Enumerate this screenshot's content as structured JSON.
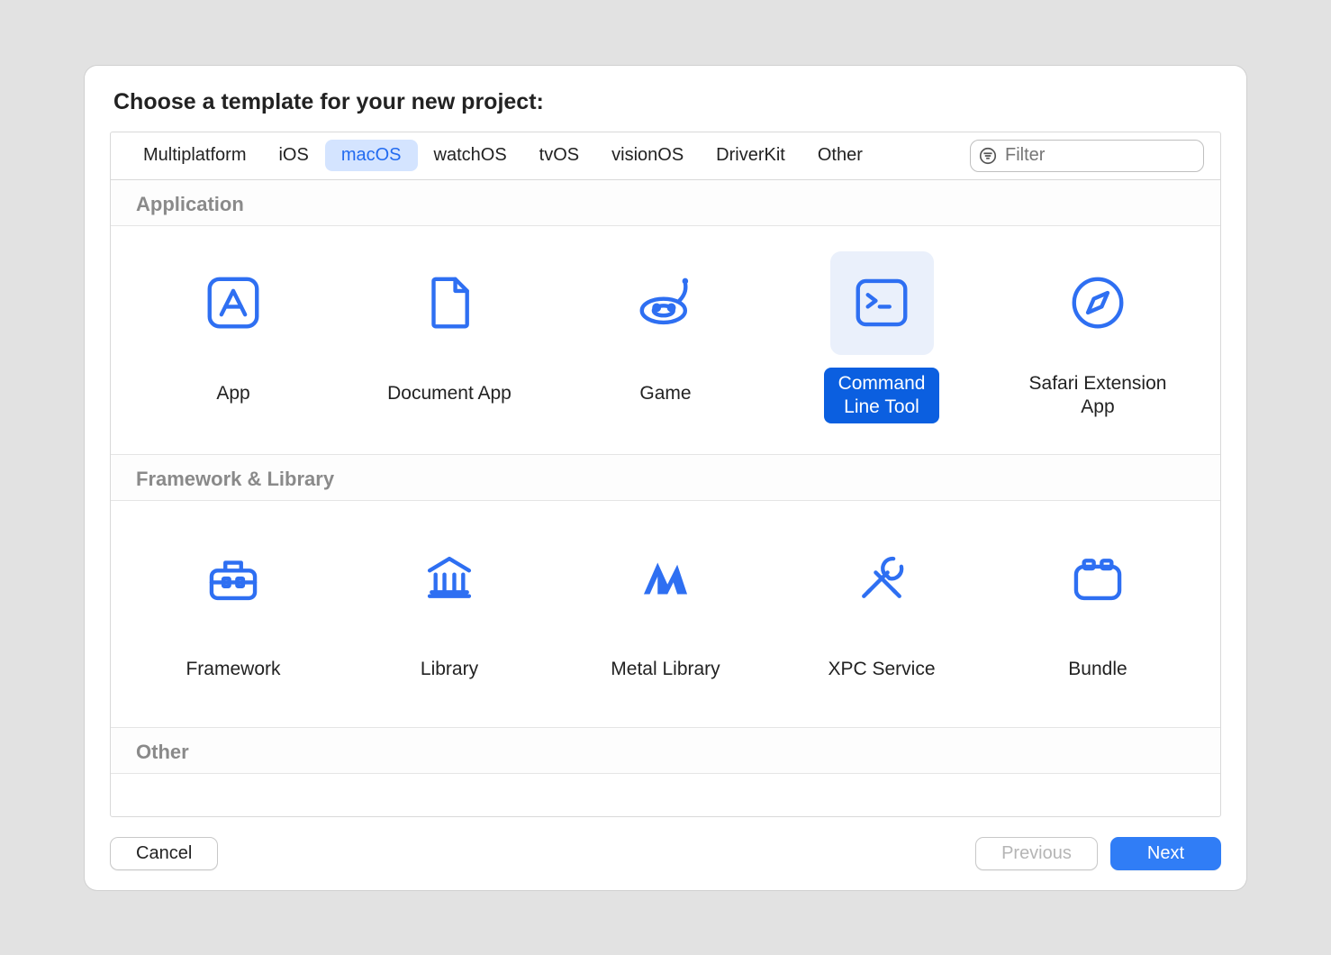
{
  "title": "Choose a template for your new project:",
  "tabs": [
    {
      "label": "Multiplatform",
      "active": false
    },
    {
      "label": "iOS",
      "active": false
    },
    {
      "label": "macOS",
      "active": true
    },
    {
      "label": "watchOS",
      "active": false
    },
    {
      "label": "tvOS",
      "active": false
    },
    {
      "label": "visionOS",
      "active": false
    },
    {
      "label": "DriverKit",
      "active": false
    },
    {
      "label": "Other",
      "active": false
    }
  ],
  "filter": {
    "placeholder": "Filter",
    "value": ""
  },
  "sections": {
    "application": {
      "heading": "Application",
      "items": [
        {
          "label": "App"
        },
        {
          "label": "Document App"
        },
        {
          "label": "Game"
        },
        {
          "label": "Command\nLine Tool",
          "selected": true
        },
        {
          "label": "Safari Extension\nApp"
        }
      ]
    },
    "framework": {
      "heading": "Framework & Library",
      "items": [
        {
          "label": "Framework"
        },
        {
          "label": "Library"
        },
        {
          "label": "Metal Library"
        },
        {
          "label": "XPC Service"
        },
        {
          "label": "Bundle"
        }
      ]
    },
    "other": {
      "heading": "Other",
      "items": [
        {
          "label": ""
        },
        {
          "label": ""
        },
        {
          "label": ""
        },
        {
          "label": ""
        },
        {
          "label": ""
        }
      ]
    }
  },
  "buttons": {
    "cancel": "Cancel",
    "previous": "Previous",
    "next": "Next"
  },
  "colors": {
    "accent": "#307df6",
    "iconBlue": "#2e6ff2"
  }
}
